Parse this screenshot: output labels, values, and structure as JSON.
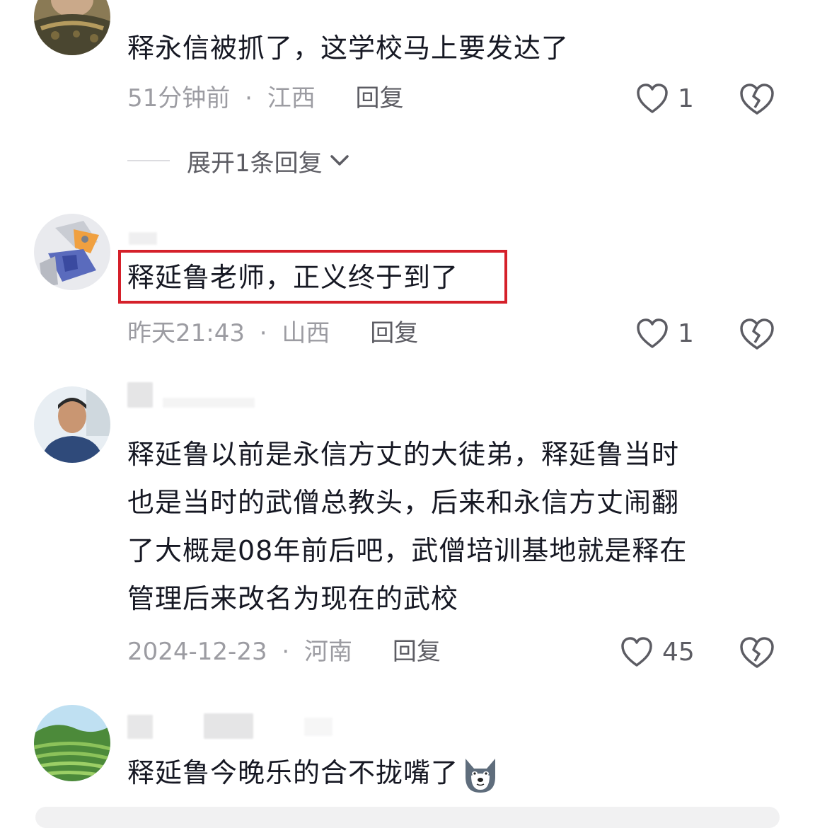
{
  "comments": [
    {
      "text": "释永信被抓了，这学校马上要发达了",
      "time": "51分钟前",
      "separator": "·",
      "location": "江西",
      "reply_label": "回复",
      "likes": "1",
      "expand_label": "展开1条回复"
    },
    {
      "text": "释延鲁老师，正义终于到了",
      "time": "昨天21:43",
      "separator": "·",
      "location": "山西",
      "reply_label": "回复",
      "likes": "1"
    },
    {
      "text_lines": [
        "释延鲁以前是永信方丈的大徒弟，释延鲁当时",
        "也是当时的武僧总教头，后来和永信方丈闹翻",
        "了大概是08年前后吧，武僧培训基地就是释在",
        "管理后来改名为现在的武校"
      ],
      "time": "2024-12-23",
      "separator": "·",
      "location": "河南",
      "reply_label": "回复",
      "likes": "45"
    },
    {
      "text": "释延鲁今晚乐的合不拢嘴了",
      "emoji": "wolf-face-emoji"
    }
  ],
  "icons": {
    "like": "heart-outline-icon",
    "dislike": "broken-heart-icon",
    "expand": "chevron-down-icon"
  },
  "colors": {
    "text": "#161823",
    "meta": "#9c9ca2",
    "action": "#5c5c63",
    "highlight_border": "#d5202a"
  }
}
